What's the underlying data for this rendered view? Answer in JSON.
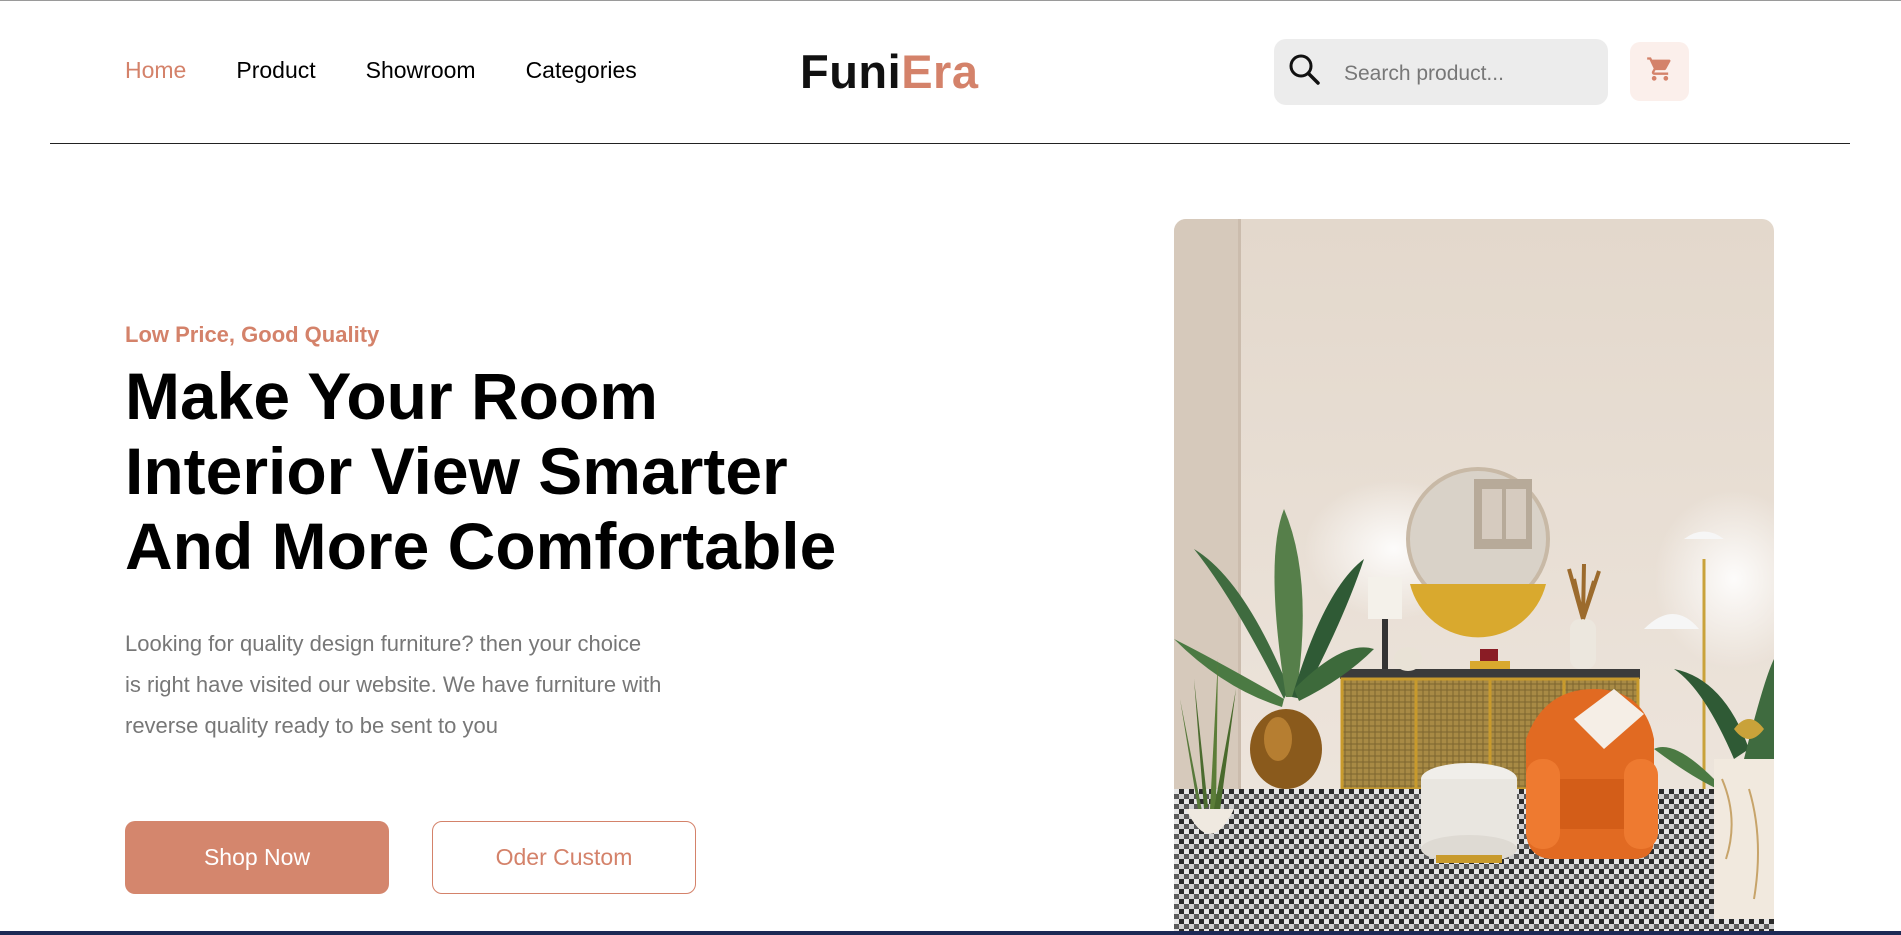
{
  "nav": {
    "items": [
      {
        "label": "Home",
        "active": true
      },
      {
        "label": "Product",
        "active": false
      },
      {
        "label": "Showroom",
        "active": false
      },
      {
        "label": "Categories",
        "active": false
      }
    ]
  },
  "logo": {
    "part1": "Funi",
    "part2": "Era"
  },
  "search": {
    "placeholder": "Search product...",
    "icon": "search-icon"
  },
  "cart": {
    "icon": "cart-icon"
  },
  "hero": {
    "tagline": "Low Price, Good Quality",
    "headline_lines": [
      "Make Your Room",
      "Interior View Smarter",
      "And More Comfortable"
    ],
    "description_lines": [
      "Looking for quality design furniture? then your choice",
      "is right have visited our website. We have furniture with",
      "reverse quality ready to be sent to you"
    ],
    "primary_button": "Shop Now",
    "secondary_button": "Oder Custom",
    "image": "living-room-image"
  },
  "colors": {
    "accent": "#d4826a",
    "button_fill": "#d4866d",
    "search_bg": "#ececec",
    "cart_bg": "#fbefeb",
    "muted_text": "#777777"
  }
}
